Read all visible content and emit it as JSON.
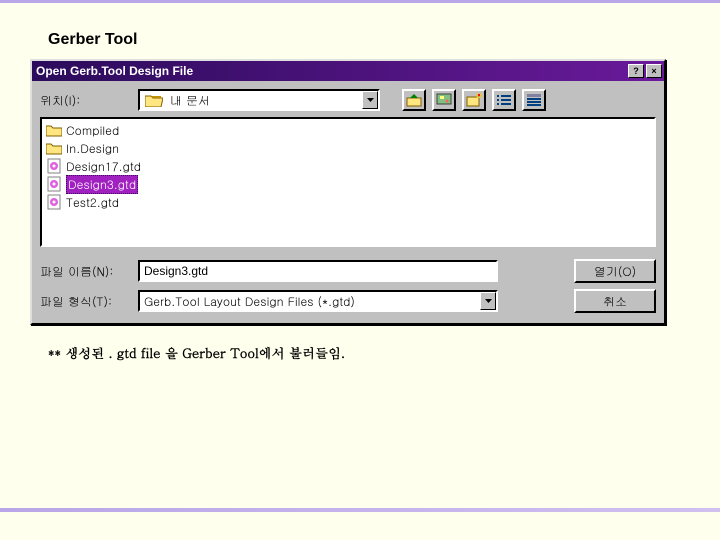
{
  "section_title": "Gerber Tool",
  "dialog": {
    "title": "Open Gerb.Tool Design File",
    "help_glyph": "?",
    "close_glyph": "×",
    "location_label": "위치(I):",
    "location_value": "내 문서",
    "files": [
      {
        "name": "Compiled",
        "type": "folder",
        "selected": false
      },
      {
        "name": "In.Design",
        "type": "folder",
        "selected": false
      },
      {
        "name": "Design17.gtd",
        "type": "gtd",
        "selected": false
      },
      {
        "name": "Design3.gtd",
        "type": "gtd",
        "selected": true
      },
      {
        "name": "Test2.gtd",
        "type": "gtd",
        "selected": false
      }
    ],
    "filename_label": "파일 이름(N):",
    "filename_value": "Design3.gtd",
    "filetype_label": "파일 형식(T):",
    "filetype_value": "Gerb.Tool Layout Design Files (*.gtd)",
    "open_label": "열기(O)",
    "cancel_label": "취소"
  },
  "footnote": "** 생성된  . gtd file 을 Gerber Tool에서 불러들임."
}
